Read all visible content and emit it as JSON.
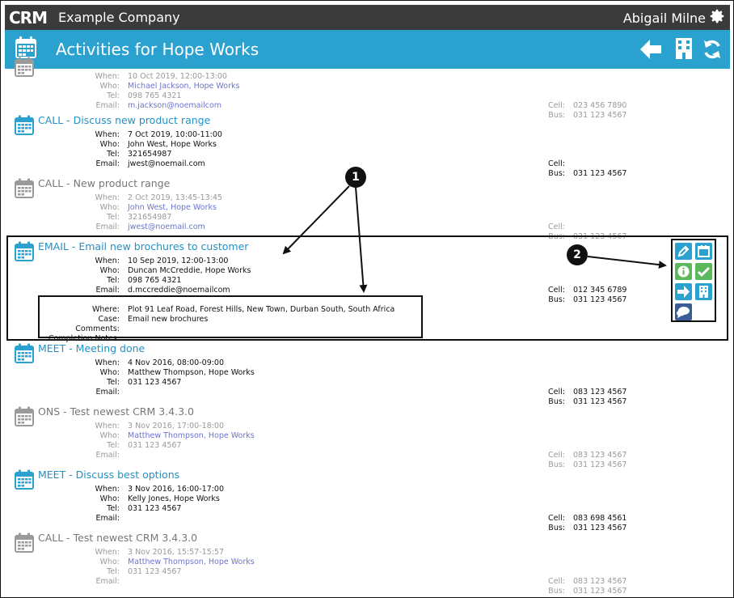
{
  "app": {
    "logo_text": "CRM",
    "company": "Example Company",
    "user": "Abigail Milne"
  },
  "header": {
    "title": "Activities for Hope Works"
  },
  "labels": {
    "when": "When:",
    "who": "Who:",
    "tel": "Tel:",
    "email": "Email:",
    "cell": "Cell:",
    "bus": "Bus:",
    "where": "Where:",
    "case": "Case:",
    "comments": "Comments:",
    "completion_notes": "Completion Notes:"
  },
  "activities": [
    {
      "title": "",
      "status": "done",
      "when": "10 Oct 2019, 12:00-13:00",
      "who": "Michael Jackson, Hope Works",
      "tel": "098 765 4321",
      "email": "m.jackson@noemailcom",
      "cell": "023 456 7890",
      "bus": "031 123 4567"
    },
    {
      "title": "CALL - Discuss new product range",
      "status": "active",
      "when": "7 Oct 2019, 10:00-11:00",
      "who": "John West, Hope Works",
      "tel": "321654987",
      "email": "jwest@noemail.com",
      "cell": "",
      "bus": "031 123 4567"
    },
    {
      "title": "CALL - New product range",
      "status": "done",
      "when": "2 Oct 2019, 13:45-13:45",
      "who": "John West, Hope Works",
      "tel": "321654987",
      "email": "jwest@noemail.com",
      "cell": "",
      "bus": "031 123 4567"
    },
    {
      "title": "EMAIL - Email new brochures to customer",
      "status": "active",
      "when": "10 Sep 2019, 12:00-13:00",
      "who": "Duncan McCreddie, Hope Works",
      "tel": "098 765 4321",
      "email": "d.mccreddie@noemailcom",
      "cell": "012 345 6789",
      "bus": "031 123 4567",
      "where": "Plot 91 Leaf Road, Forest Hills, New Town, Durban South, South Africa",
      "case": "Email new brochures",
      "comments": "",
      "completion_notes": ""
    },
    {
      "title": "MEET - Meeting done",
      "status": "active",
      "when": "4 Nov 2016, 08:00-09:00",
      "who": "Matthew Thompson, Hope Works",
      "tel": "031 123 4567",
      "email": "",
      "cell": "083 123 4567",
      "bus": "031 123 4567"
    },
    {
      "title": "ONS - Test newest CRM 3.4.3.0",
      "status": "done",
      "when": "3 Nov 2016, 17:00-18:00",
      "who": "Matthew Thompson, Hope Works",
      "tel": "031 123 4567",
      "email": "",
      "cell": "083 123 4567",
      "bus": "031 123 4567"
    },
    {
      "title": "MEET - Discuss best options",
      "status": "active",
      "when": "3 Nov 2016, 16:00-17:00",
      "who": "Kelly Jones, Hope Works",
      "tel": "031 123 4567",
      "email": "",
      "cell": "083 698 4561",
      "bus": "031 123 4567"
    },
    {
      "title": "CALL - Test newest CRM 3.4.3.0",
      "status": "done",
      "when": "3 Nov 2016, 15:57-15:57",
      "who": "Matthew Thompson, Hope Works",
      "tel": "031 123 4567",
      "email": "",
      "cell": "083 123 4567",
      "bus": "031 123 4567"
    }
  ],
  "callouts": [
    "1",
    "2"
  ],
  "icons": {
    "action_panel": [
      "edit-icon",
      "calendar-icon",
      "info-icon",
      "check-icon",
      "forward-arrow-icon",
      "building-icon",
      "comment-icon"
    ],
    "header": [
      "back-arrow-icon",
      "building-icon",
      "refresh-icon"
    ]
  },
  "colors": {
    "topbar": "#3a3a3a",
    "header": "#2aa1cf",
    "active_title": "#2590c4",
    "link": "#2d39c8",
    "done_text": "#999999",
    "panel_blue": "#2aa1cf",
    "panel_green": "#5cb85c",
    "panel_navy": "#3b5b99"
  }
}
